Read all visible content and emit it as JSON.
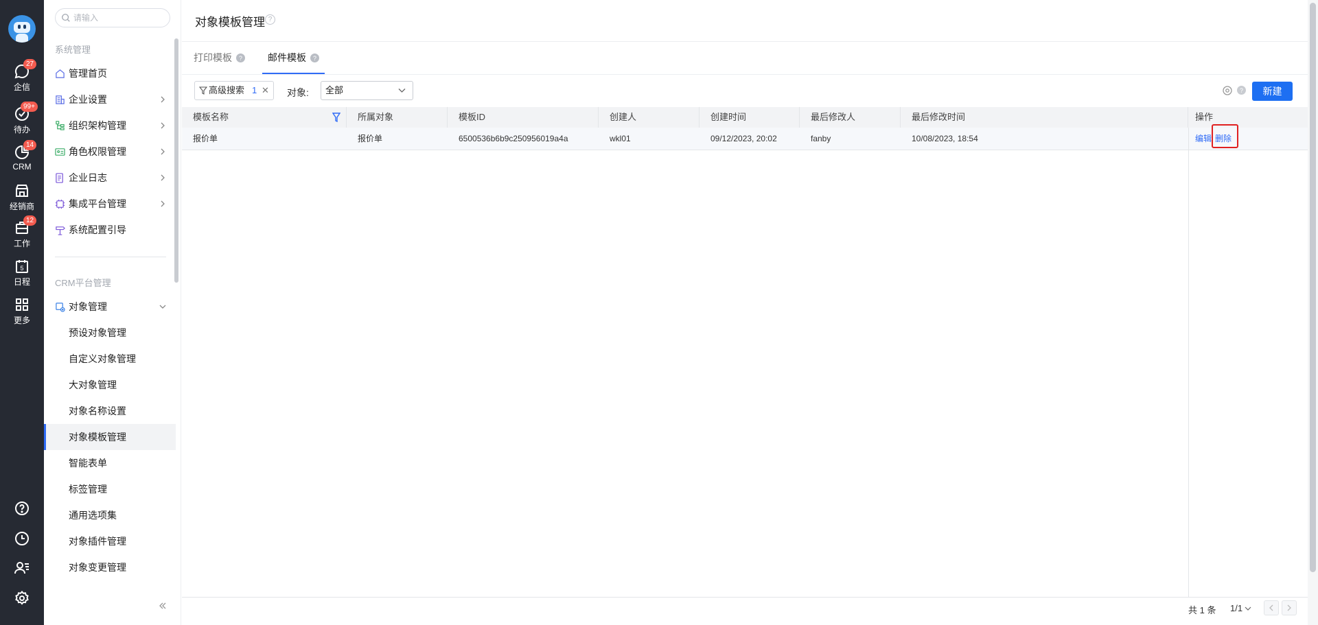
{
  "rail": {
    "items": [
      {
        "label": "企信",
        "badge": "27",
        "icon": "chat-icon"
      },
      {
        "label": "待办",
        "badge": "99+",
        "icon": "check-circle-icon"
      },
      {
        "label": "CRM",
        "badge": "14",
        "icon": "pie-chart-icon"
      },
      {
        "label": "经销商",
        "badge": "",
        "icon": "store-icon"
      },
      {
        "label": "工作",
        "badge": "12",
        "icon": "briefcase-icon"
      },
      {
        "label": "日程",
        "badge": "",
        "icon": "calendar-icon",
        "day": "5"
      },
      {
        "label": "更多",
        "badge": "",
        "icon": "grid-icon"
      }
    ],
    "bottom_icons": [
      "help-circle-icon",
      "clock-icon",
      "user-list-icon",
      "settings-icon"
    ]
  },
  "nav": {
    "search_placeholder": "请输入",
    "group1": "系统管理",
    "group1_items": [
      "管理首页",
      "企业设置",
      "组织架构管理",
      "角色权限管理",
      "企业日志",
      "集成平台管理",
      "系统配置引导"
    ],
    "group2": "CRM平台管理",
    "object_mgmt": "对象管理",
    "sub_items": [
      "预设对象管理",
      "自定义对象管理",
      "大对象管理",
      "对象名称设置",
      "对象模板管理",
      "智能表单",
      "标签管理",
      "通用选项集",
      "对象插件管理",
      "对象变更管理"
    ],
    "active": "对象模板管理"
  },
  "page": {
    "title": "对象模板管理",
    "tabs": [
      "打印模板",
      "邮件模板"
    ],
    "active_tab": "邮件模板"
  },
  "toolbar": {
    "advanced_search": "高级搜索",
    "advanced_count": "1",
    "object_label": "对象:",
    "object_value": "全部",
    "new_button": "新建"
  },
  "table": {
    "columns": [
      "模板名称",
      "所属对象",
      "模板ID",
      "创建人",
      "创建时间",
      "最后修改人",
      "最后修改时间",
      "操作"
    ],
    "rows": [
      {
        "name": "报价单",
        "object": "报价单",
        "id": "6500536b6b9c250956019a4a",
        "creator": "wkl01",
        "created": "09/12/2023, 20:02",
        "modifier": "fanby",
        "modified": "10/08/2023, 18:54",
        "edit": "编辑",
        "delete": "删除"
      }
    ]
  },
  "footer": {
    "total": "共 1 条",
    "page": "1/1"
  },
  "colors": {
    "accent": "#2f6bf6",
    "rail": "#262a33",
    "badge": "#f35b4f",
    "highlight": "#e02020"
  }
}
